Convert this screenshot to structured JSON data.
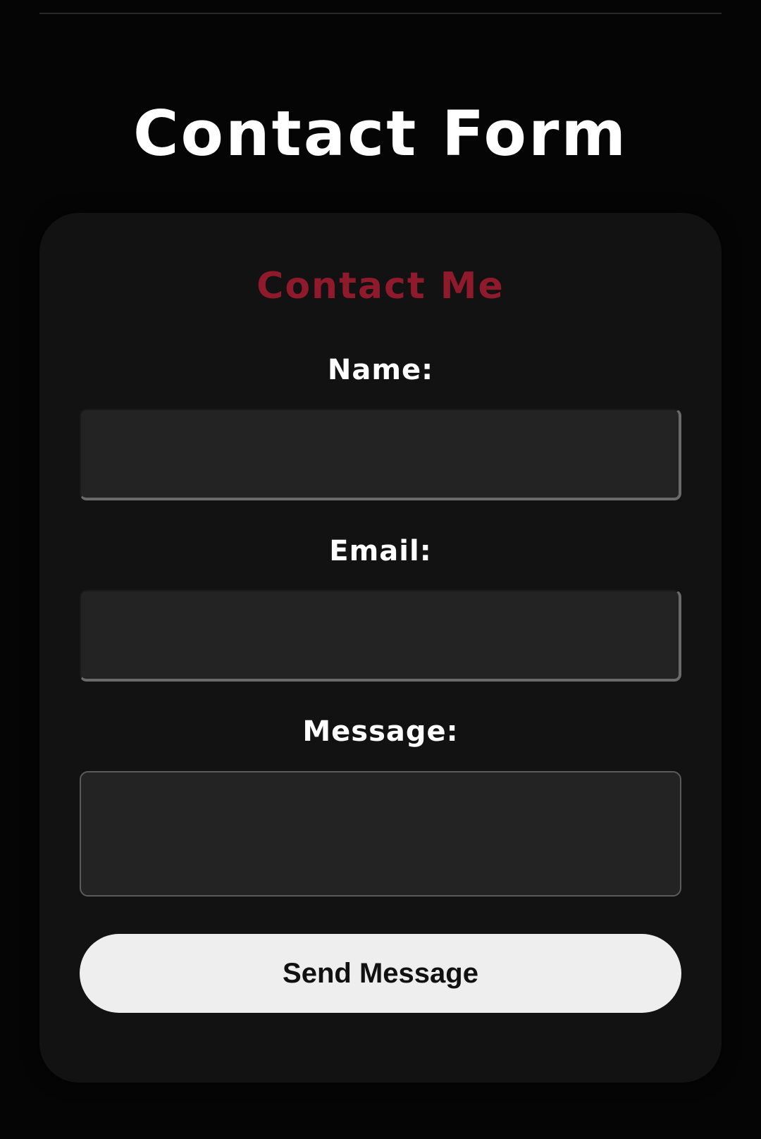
{
  "page": {
    "title": "Contact Form"
  },
  "form": {
    "heading": "Contact Me",
    "name_label": "Name:",
    "name_value": "",
    "email_label": "Email:",
    "email_value": "",
    "message_label": "Message:",
    "message_value": "",
    "submit_label": "Send Message"
  },
  "colors": {
    "background": "#050505",
    "card": "#121212",
    "accent": "#8f1a2c",
    "input": "#232323",
    "button": "#eeeeee"
  }
}
